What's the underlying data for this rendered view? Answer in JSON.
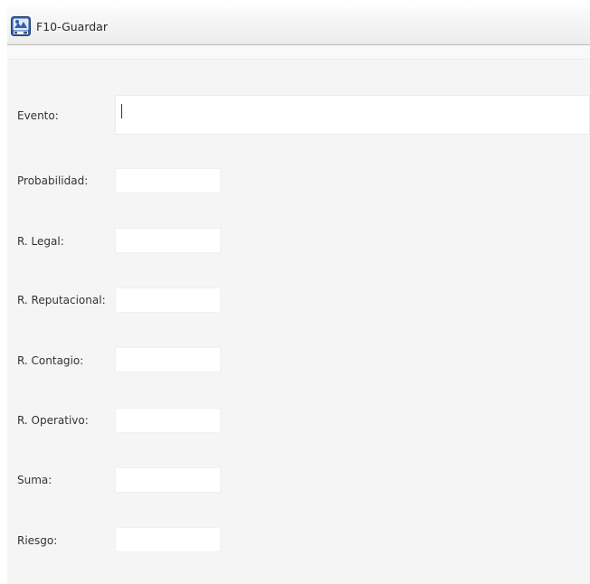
{
  "toolbar": {
    "save_label": "F10-Guardar",
    "save_icon": "save-form-icon"
  },
  "form": {
    "evento": {
      "label": "Evento:",
      "value": ""
    },
    "probabilidad": {
      "label": "Probabilidad:",
      "value": ""
    },
    "r_legal": {
      "label": "R. Legal:",
      "value": ""
    },
    "r_reputacional": {
      "label": "R. Reputacional:",
      "value": ""
    },
    "r_contagio": {
      "label": "R. Contagio:",
      "value": ""
    },
    "r_operativo": {
      "label": "R. Operativo:",
      "value": ""
    },
    "suma": {
      "label": "Suma:",
      "value": ""
    },
    "riesgo": {
      "label": "Riesgo:",
      "value": ""
    }
  },
  "colors": {
    "panel_background": "#f5f5f5",
    "field_background": "#ffffff",
    "text": "#333333"
  }
}
